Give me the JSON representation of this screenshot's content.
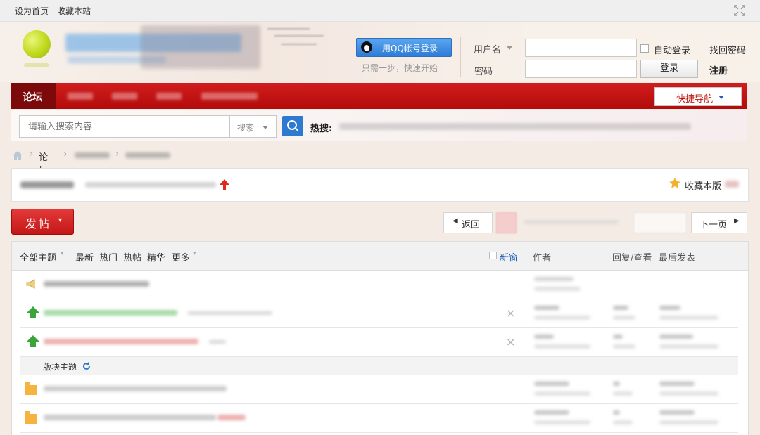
{
  "topbar": {
    "set_home": "设为首页",
    "bookmark_site": "收藏本站"
  },
  "header": {
    "qq_login": "用QQ帐号登录",
    "qq_hint": "只需一步，快速开始",
    "username_label": "用户名",
    "password_label": "密码",
    "auto_login": "自动登录",
    "forgot_password": "找回密码",
    "login_button": "登录",
    "register": "注册"
  },
  "nav": {
    "active_tab": "论坛",
    "quick_nav": "快捷导航"
  },
  "search": {
    "placeholder": "请输入搜索内容",
    "type": "搜索",
    "hot_label": "热搜:"
  },
  "breadcrumb": {
    "home": "论坛"
  },
  "forum": {
    "favorite": "收藏本版"
  },
  "toolbar": {
    "post": "发帖",
    "back": "返回",
    "next_page": "下一页"
  },
  "list": {
    "filters": [
      "全部主题",
      "最新",
      "热门",
      "热帖",
      "精华",
      "更多"
    ],
    "new_window": "新窗",
    "col_author": "作者",
    "col_reply_view": "回复/查看",
    "col_last_post": "最后发表",
    "section_label": "版块主题"
  },
  "colors": {
    "brand_red": "#c0140f",
    "accent_blue": "#2f7ad1"
  }
}
